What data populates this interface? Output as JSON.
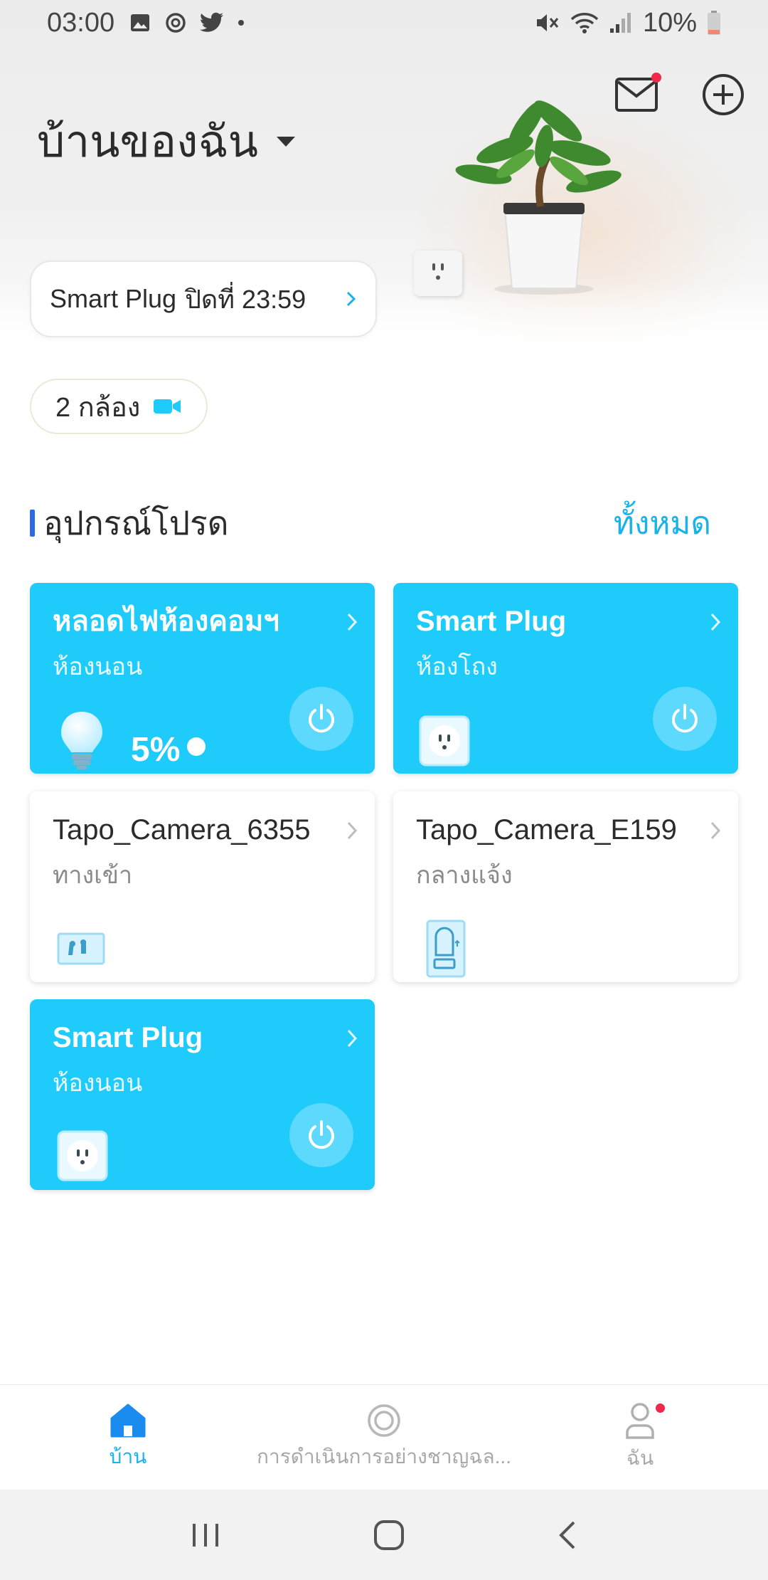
{
  "status_bar": {
    "time": "03:00",
    "battery": "10%",
    "notification_icons": [
      "gallery-icon",
      "sync-icon",
      "twitter-icon",
      "dot-icon"
    ],
    "system_icons": [
      "mute-icon",
      "wifi-icon",
      "signal-icon",
      "battery-icon"
    ]
  },
  "header": {
    "home_name": "บ้านของฉัน",
    "actions": [
      "messages-icon",
      "add-icon"
    ],
    "has_unread_messages": true
  },
  "schedule": {
    "device": "Smart Plug",
    "text": "ปิดที่ 23:59"
  },
  "cameras": {
    "label": "2 กล้อง"
  },
  "favorites": {
    "title": "อุปกรณ์โปรด",
    "see_all": "ทั้งหมด"
  },
  "devices": [
    {
      "name": "หลอดไฟห้องคอมฯ",
      "room": "ห้องนอน",
      "state": "on",
      "icon": "bulb-icon",
      "brightness": "5%"
    },
    {
      "name": "Smart Plug",
      "room": "ห้องโถง",
      "state": "on",
      "icon": "plug-icon"
    },
    {
      "name": "Tapo_Camera_6355",
      "room": "ทางเข้า",
      "state": "off",
      "icon": "camera-thumbnail-icon"
    },
    {
      "name": "Tapo_Camera_E159",
      "room": "กลางแจ้ง",
      "state": "off",
      "icon": "door-camera-icon"
    },
    {
      "name": "Smart Plug",
      "room": "ห้องนอน",
      "state": "on",
      "icon": "plug-icon"
    }
  ],
  "bottom_nav": {
    "items": [
      {
        "label": "บ้าน",
        "icon": "home-icon",
        "active": true
      },
      {
        "label": "การดำเนินการอย่างชาญฉล...",
        "icon": "smart-actions-icon",
        "active": false
      },
      {
        "label": "ฉัน",
        "icon": "profile-icon",
        "active": false
      }
    ]
  },
  "colors": {
    "accent": "#1ecbfb",
    "link": "#19b3ea",
    "section_bar": "#2c6bdf",
    "badge": "#f0294b"
  }
}
